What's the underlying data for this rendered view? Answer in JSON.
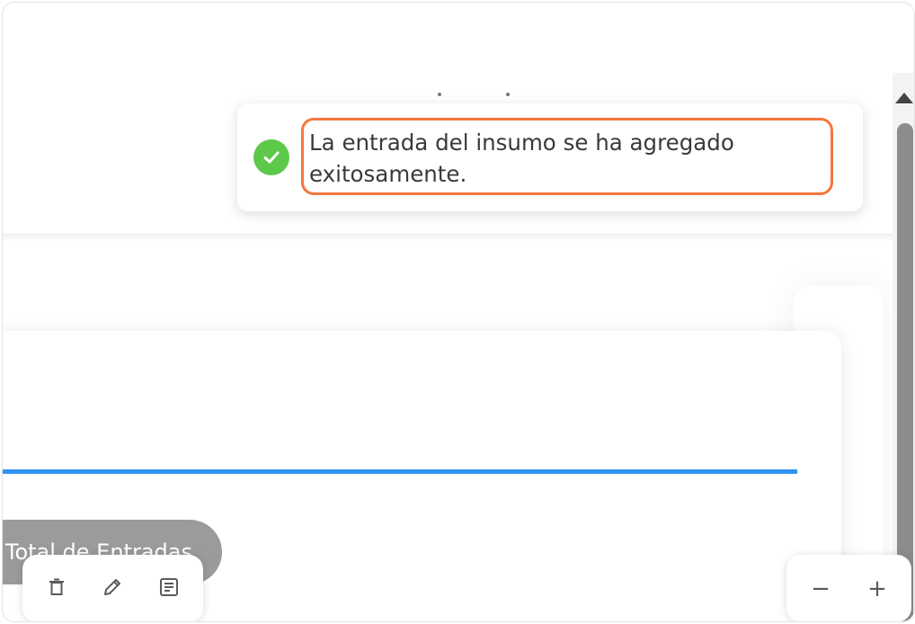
{
  "toast": {
    "message": "La entrada del insumo se ha agregado exitosamente.",
    "status_icon": "check-circle-icon",
    "status_color": "#5cc94a",
    "highlight_color": "#f4773e"
  },
  "main": {
    "progress_color": "#2f95f2",
    "total_button_label": "Total de Entradas"
  },
  "toolbar": {
    "delete_icon": "trash-icon",
    "edit_icon": "pencil-icon",
    "notes_icon": "document-lines-icon",
    "zoom_out_label": "−",
    "zoom_in_label": "+"
  }
}
